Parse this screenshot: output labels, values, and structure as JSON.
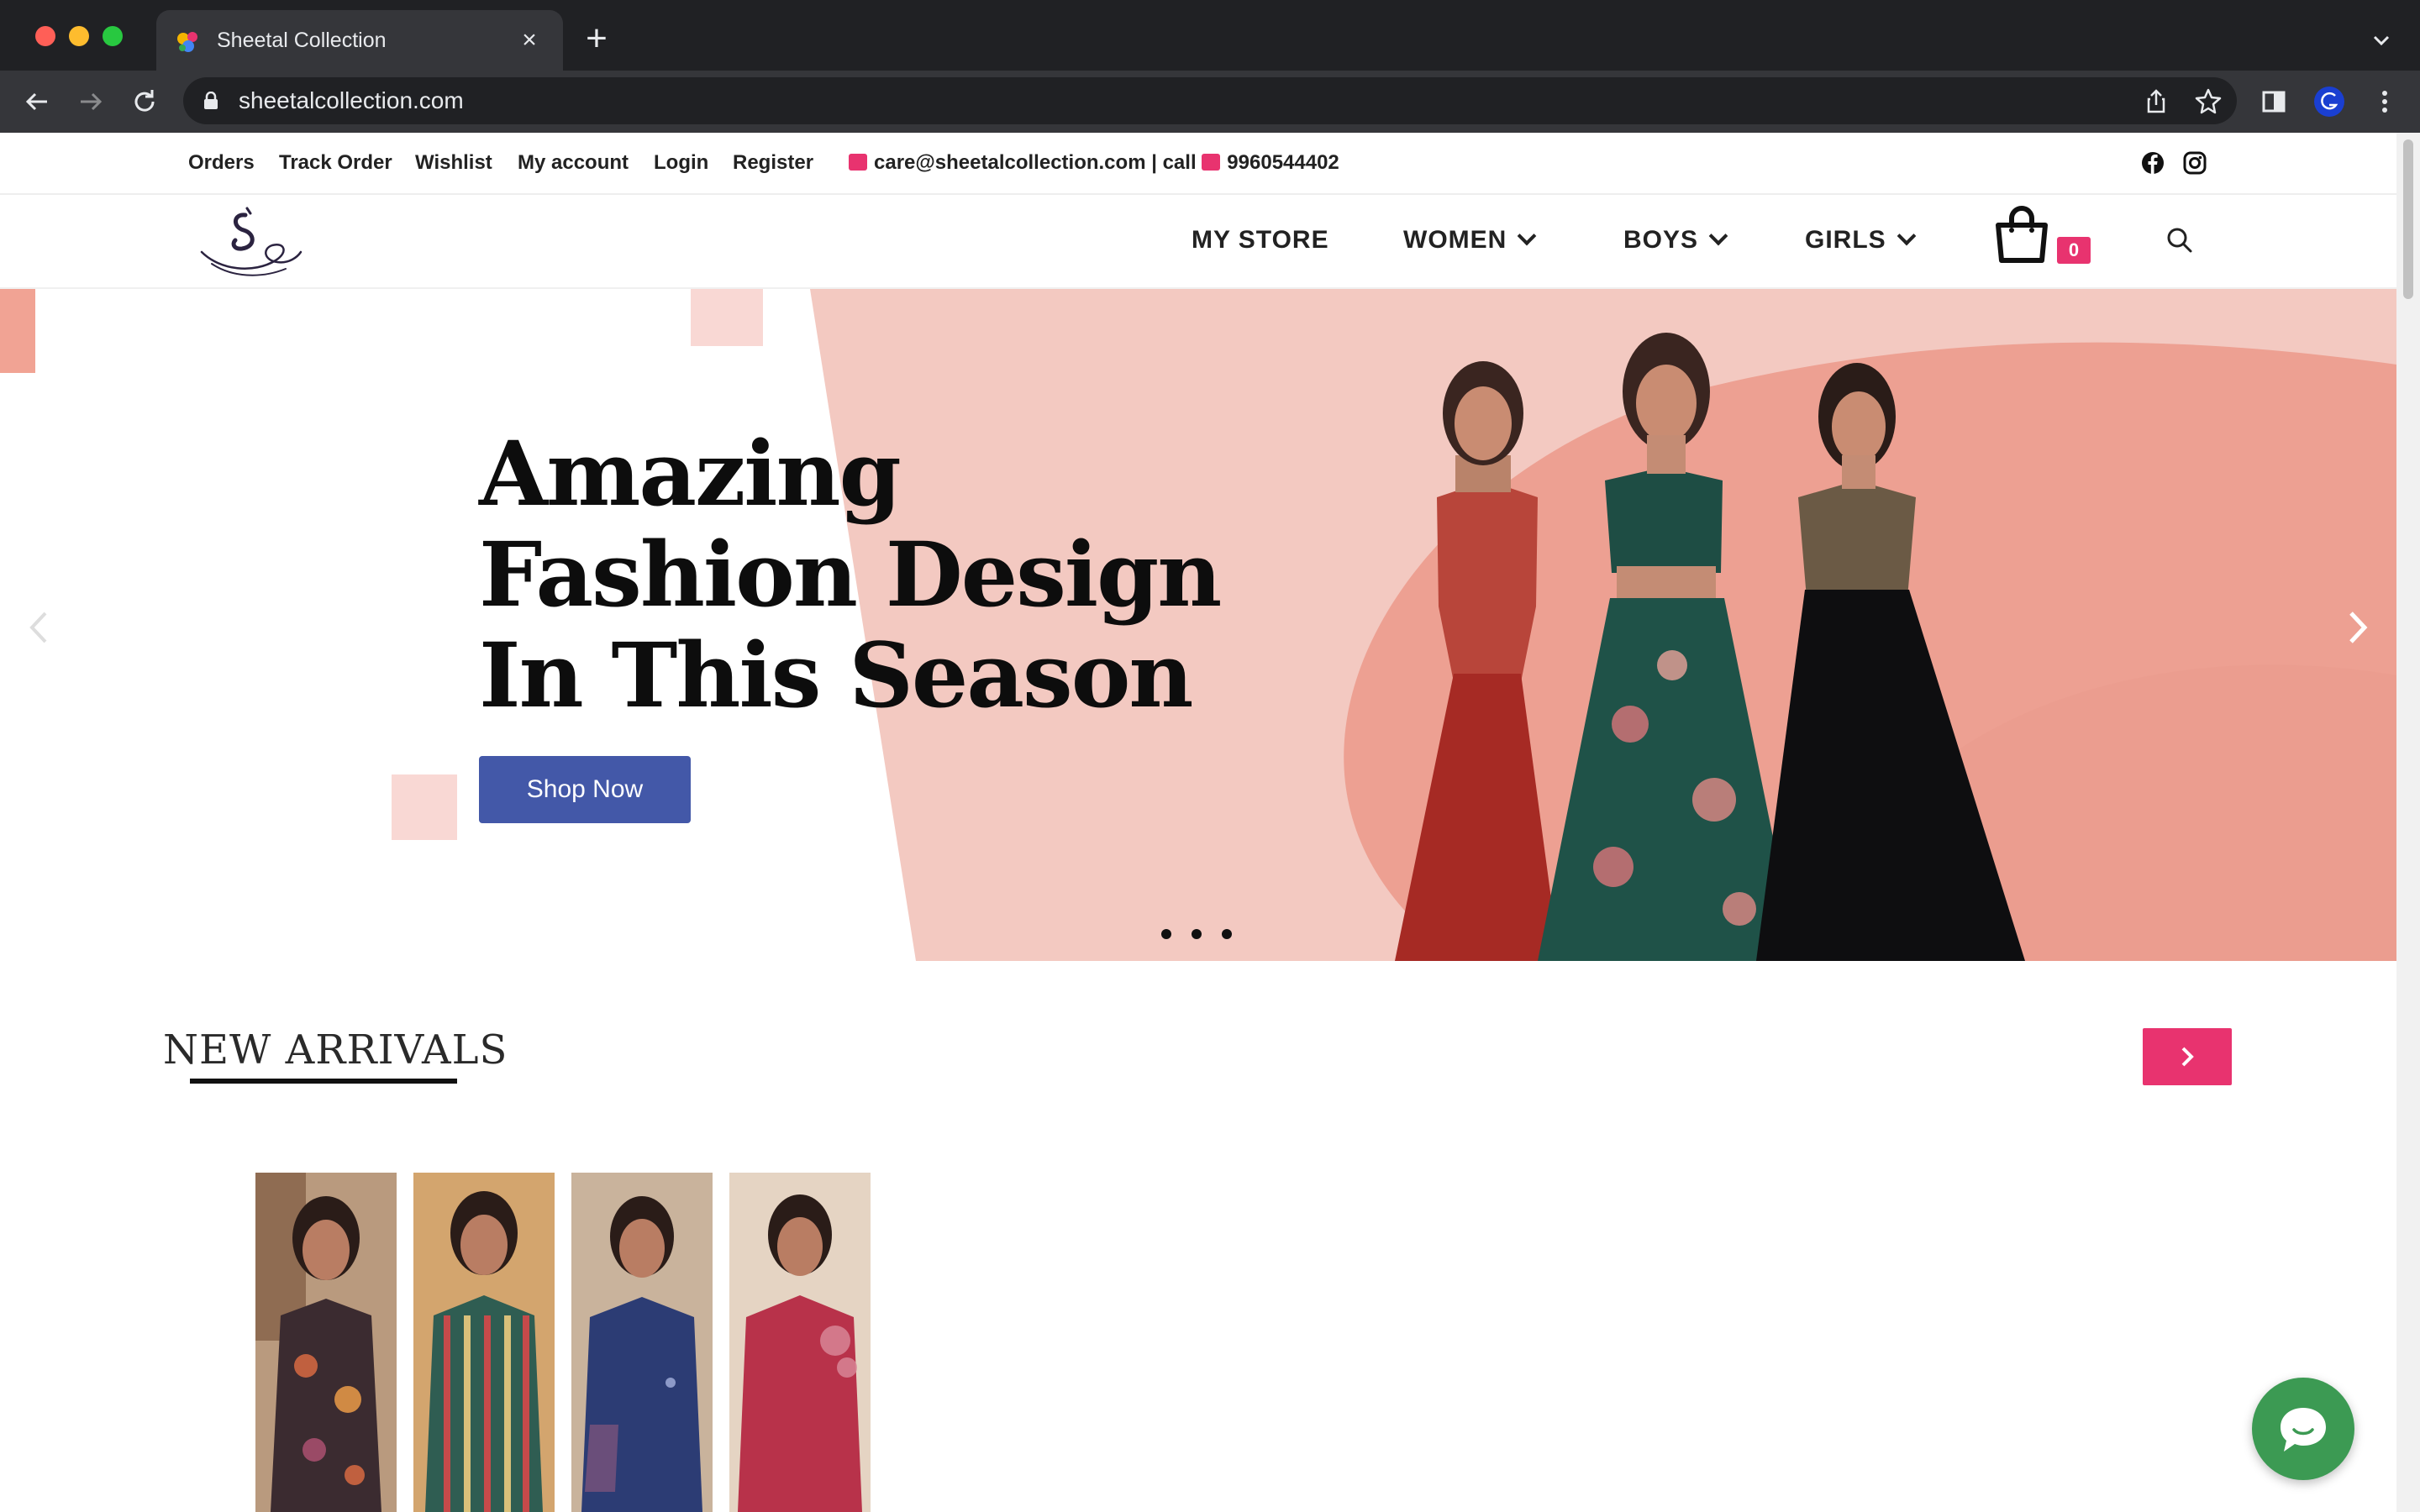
{
  "browser": {
    "tab_title": "Sheetal Collection",
    "url": "sheetalcollection.com",
    "new_tab_symbol": "+",
    "close_symbol": "×"
  },
  "topbar": {
    "links": [
      "Orders",
      "Track Order",
      "Wishlist",
      "My account",
      "Login",
      "Register"
    ],
    "contact": "care@sheetalcollection.com | call",
    "phone": "9960544402",
    "social_icons": [
      "facebook-icon",
      "instagram-icon"
    ]
  },
  "nav": {
    "items": [
      "MY STORE",
      "WOMEN",
      "BOYS",
      "GIRLS"
    ],
    "cart_count": "0"
  },
  "hero": {
    "title_lines": [
      "Amazing",
      "Fashion Design",
      "In This Season"
    ],
    "button": "Shop Now",
    "slide_count": 3
  },
  "new_arrivals": {
    "title": "NEW ARRIVALS"
  },
  "colors": {
    "accent_pink": "#e8336f",
    "button_blue": "#4358a8",
    "chat_green": "#3c9a53",
    "hero_salmon": "#eda092"
  }
}
